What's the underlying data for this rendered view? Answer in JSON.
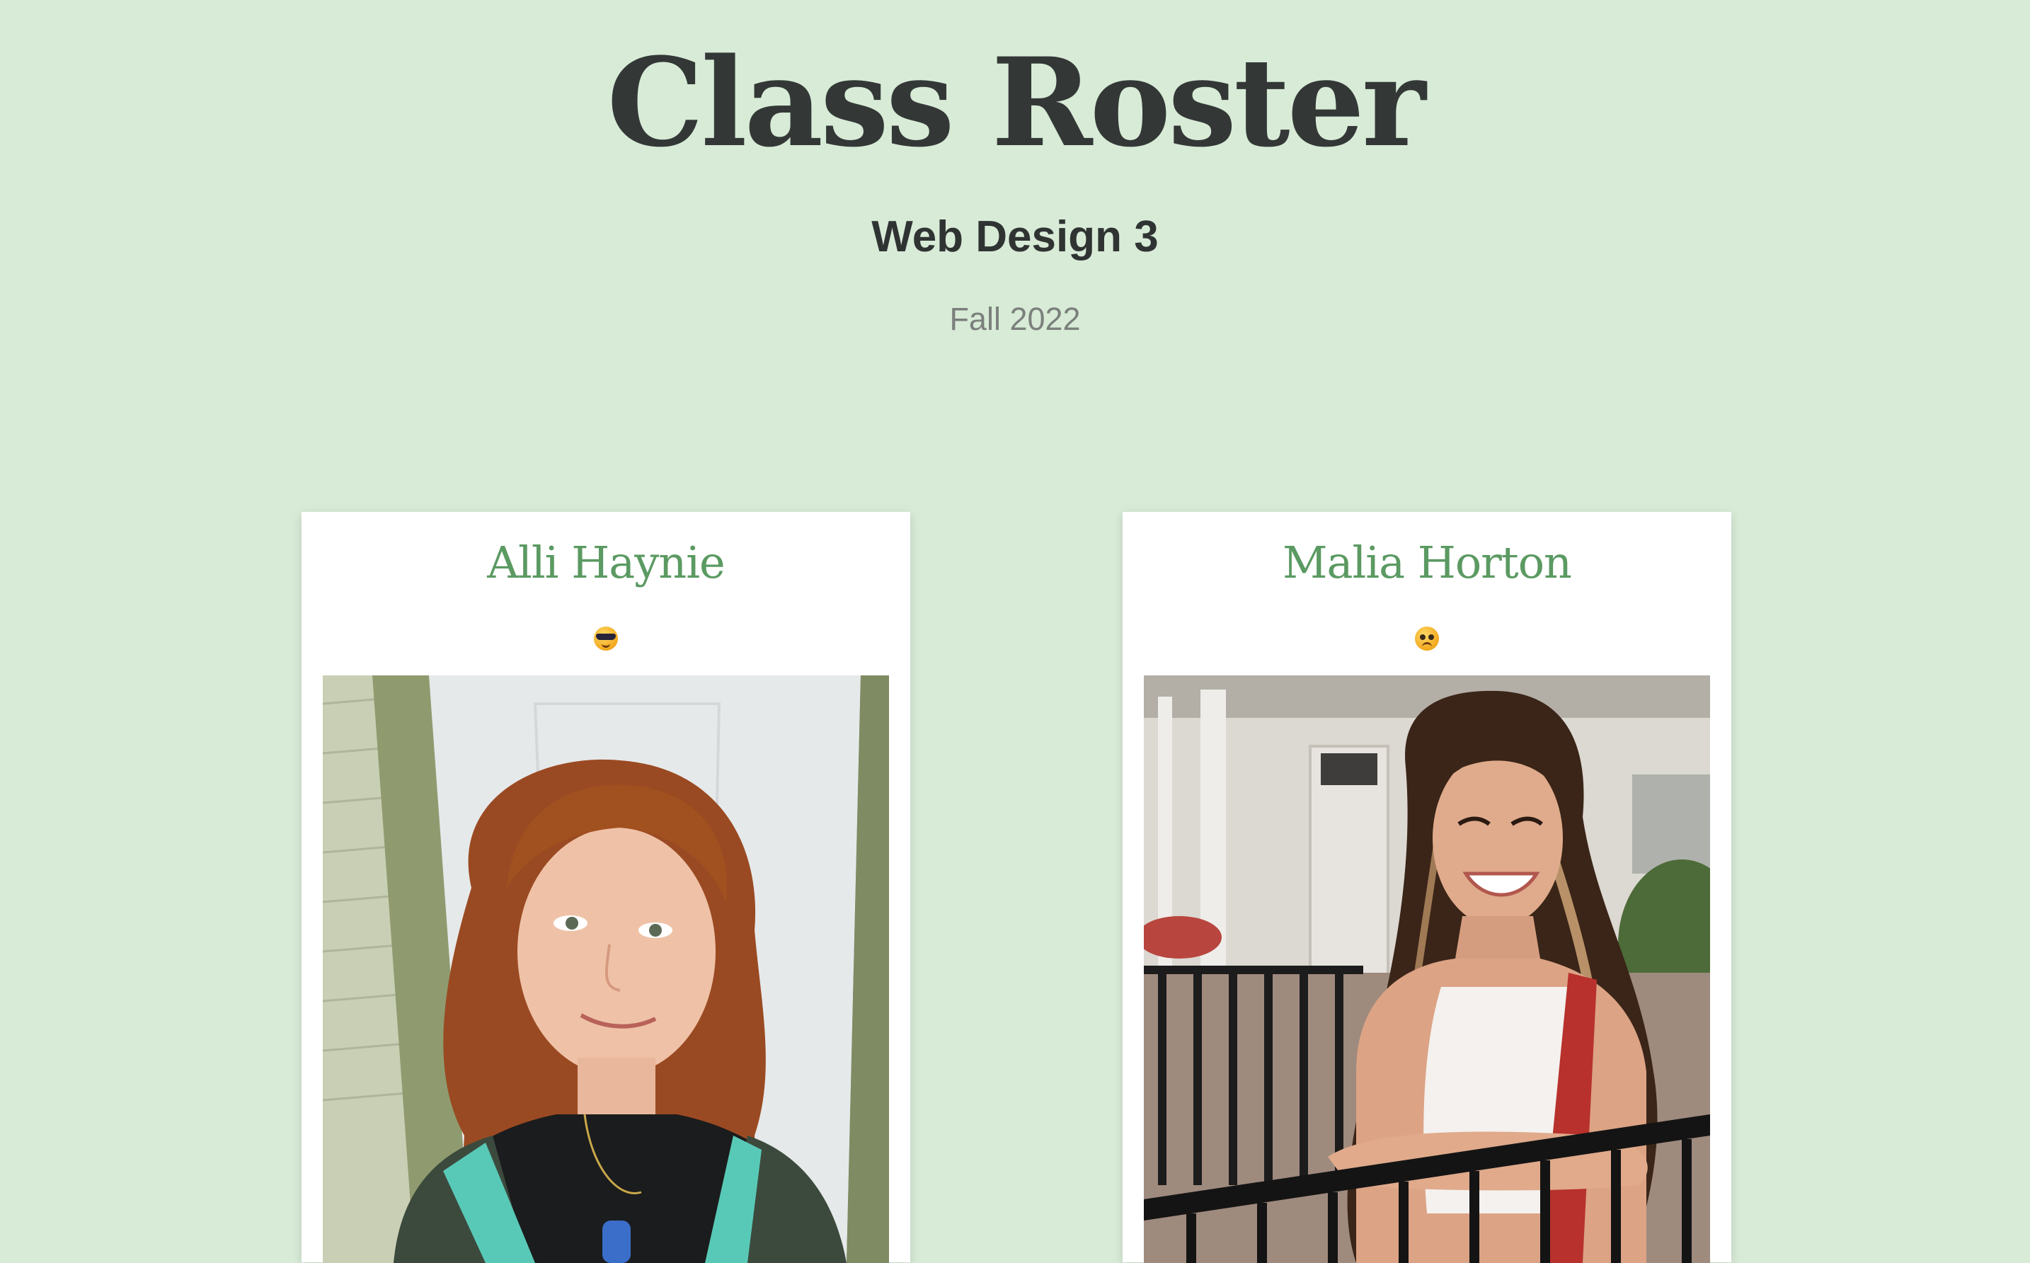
{
  "header": {
    "title": "Class Roster",
    "subtitle": "Web Design 3",
    "term": "Fall 2022"
  },
  "students": [
    {
      "name": "Alli Haynie",
      "emoji": "smiling-face-with-sunglasses-icon"
    },
    {
      "name": "Malia Horton",
      "emoji": "pleading-face-icon"
    }
  ],
  "colors": {
    "background": "#d8ebd7",
    "name_accent": "#5b9a62",
    "title_text": "#333837",
    "term_text": "#7b807c"
  }
}
